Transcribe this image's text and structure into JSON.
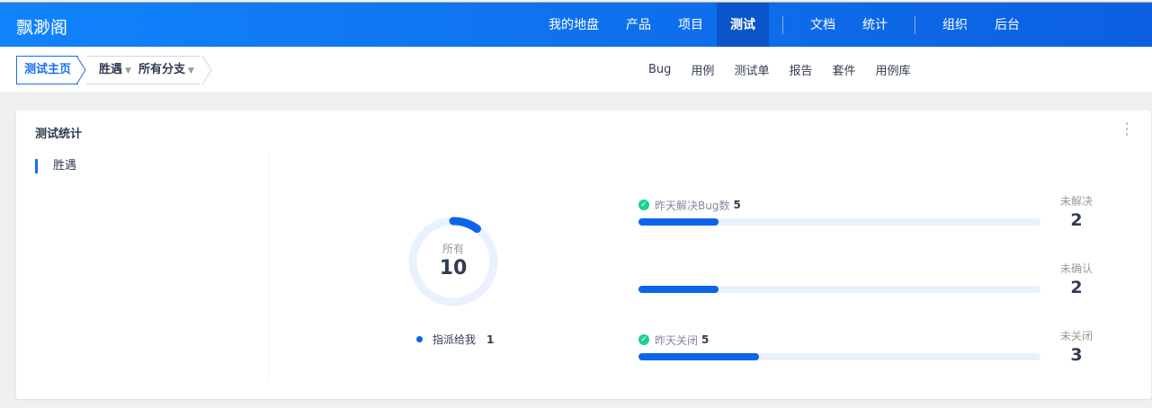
{
  "header": {
    "logo": "飘渺阁",
    "nav": [
      "我的地盘",
      "产品",
      "项目",
      "测试",
      "文档",
      "统计",
      "组织",
      "后台"
    ],
    "active": "测试"
  },
  "breadcrumb": {
    "home": "测试主页",
    "product": "胜遇",
    "branch": "所有分支"
  },
  "subnav": [
    "Bug",
    "用例",
    "测试单",
    "报告",
    "套件",
    "用例库"
  ],
  "card": {
    "title": "测试统计",
    "sidebar": [
      "胜遇"
    ],
    "ring": {
      "label": "所有",
      "value": "10",
      "progress": 0.1
    },
    "legend": {
      "label": "指派给我",
      "value": "1"
    },
    "bars": [
      {
        "label": "昨天解决Bug数",
        "value": "5",
        "progress": 0.2
      },
      {
        "label": "",
        "value": "",
        "progress": 0.2
      },
      {
        "label": "昨天关闭",
        "value": "5",
        "progress": 0.3
      }
    ],
    "stats": [
      {
        "label": "未解决",
        "value": "2"
      },
      {
        "label": "未确认",
        "value": "2"
      },
      {
        "label": "未关闭",
        "value": "3"
      }
    ]
  },
  "colors": {
    "accent": "#0c64eb",
    "success": "#1bd091"
  }
}
